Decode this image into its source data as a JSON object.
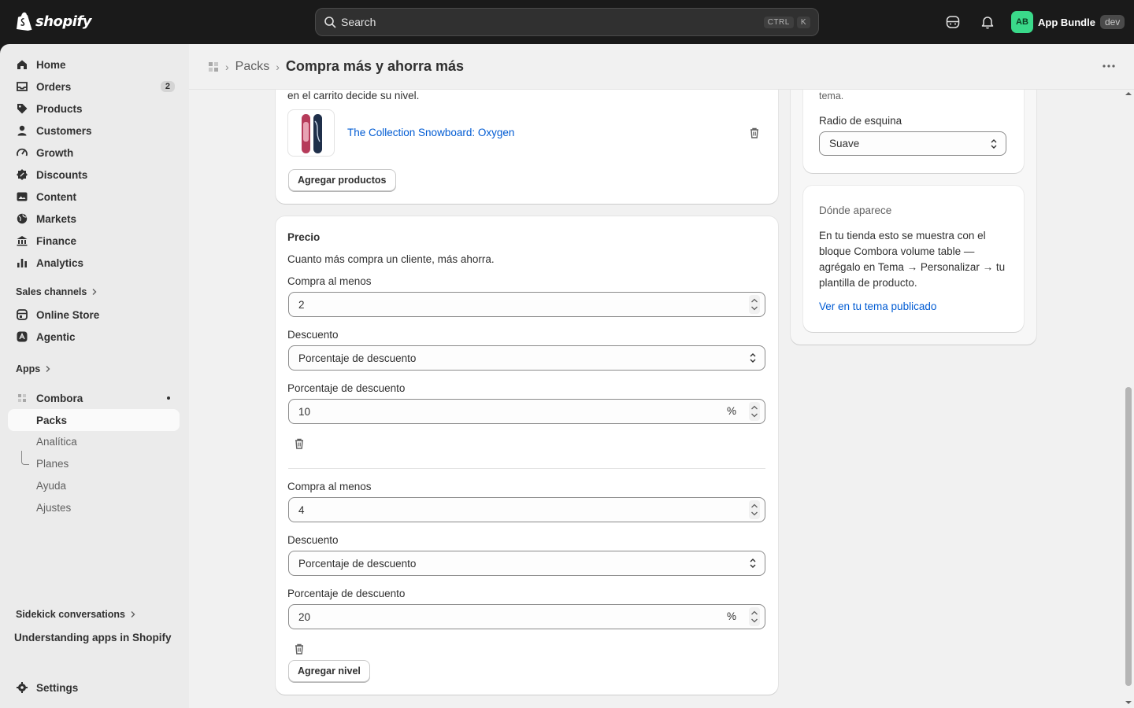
{
  "topbar": {
    "logo_text": "shopify",
    "search_placeholder": "Search",
    "kbd_ctrl": "CTRL",
    "kbd_k": "K",
    "avatar_initials": "AB",
    "account_name": "App Bundle",
    "dev_badge": "dev"
  },
  "sidebar": {
    "items": [
      {
        "label": "Home",
        "icon": "home-icon"
      },
      {
        "label": "Orders",
        "icon": "inbox-icon",
        "count": "2"
      },
      {
        "label": "Products",
        "icon": "tag-icon"
      },
      {
        "label": "Customers",
        "icon": "person-icon"
      },
      {
        "label": "Growth",
        "icon": "gauge-icon"
      },
      {
        "label": "Discounts",
        "icon": "discount-icon"
      },
      {
        "label": "Content",
        "icon": "image-icon"
      },
      {
        "label": "Markets",
        "icon": "globe-icon"
      },
      {
        "label": "Finance",
        "icon": "bank-icon"
      },
      {
        "label": "Analytics",
        "icon": "bar-chart-icon"
      }
    ],
    "sales_channels_label": "Sales channels",
    "channels": [
      {
        "label": "Online Store",
        "icon": "store-icon"
      },
      {
        "label": "Agentic",
        "icon": "agentic-icon"
      }
    ],
    "apps_label": "Apps",
    "app_name": "Combora",
    "app_subitems": [
      "Packs",
      "Analítica",
      "Planes",
      "Ayuda",
      "Ajustes"
    ],
    "sidekick_label": "Sidekick conversations",
    "sidekick_item": "Understanding apps in Shopify",
    "settings_label": "Settings"
  },
  "header": {
    "breadcrumb_link": "Packs",
    "title": "Compra más y ahorra más"
  },
  "products_card": {
    "intro_text": "en el carrito decide su nivel.",
    "product_name": "The Collection Snowboard: Oxygen",
    "add_products_button": "Agregar productos"
  },
  "price_card": {
    "heading": "Precio",
    "description": "Cuanto más compra un cliente, más ahorra.",
    "tiers": [
      {
        "min_label": "Compra al menos",
        "min_value": "2",
        "discount_label": "Descuento",
        "discount_type": "Porcentaje de descuento",
        "percent_label": "Porcentaje de descuento",
        "percent_value": "10",
        "percent_suffix": "%"
      },
      {
        "min_label": "Compra al menos",
        "min_value": "4",
        "discount_label": "Descuento",
        "discount_type": "Porcentaje de descuento",
        "percent_label": "Porcentaje de descuento",
        "percent_value": "20",
        "percent_suffix": "%"
      }
    ],
    "add_tier_button": "Agregar nivel"
  },
  "style_card": {
    "partial_text": "tema.",
    "corner_label": "Radio de esquina",
    "corner_value": "Suave"
  },
  "where_card": {
    "heading": "Dónde aparece",
    "body": "En tu tienda esto se muestra con el bloque Combora volume table — agrégalo en Tema → Personalizar → tu plantilla de producto.",
    "link": "Ver en tu tema publicado"
  },
  "colors": {
    "accent_link": "#005bd3",
    "topbar_bg": "#1a1a1a",
    "avatar_bg": "#3ad98a"
  }
}
